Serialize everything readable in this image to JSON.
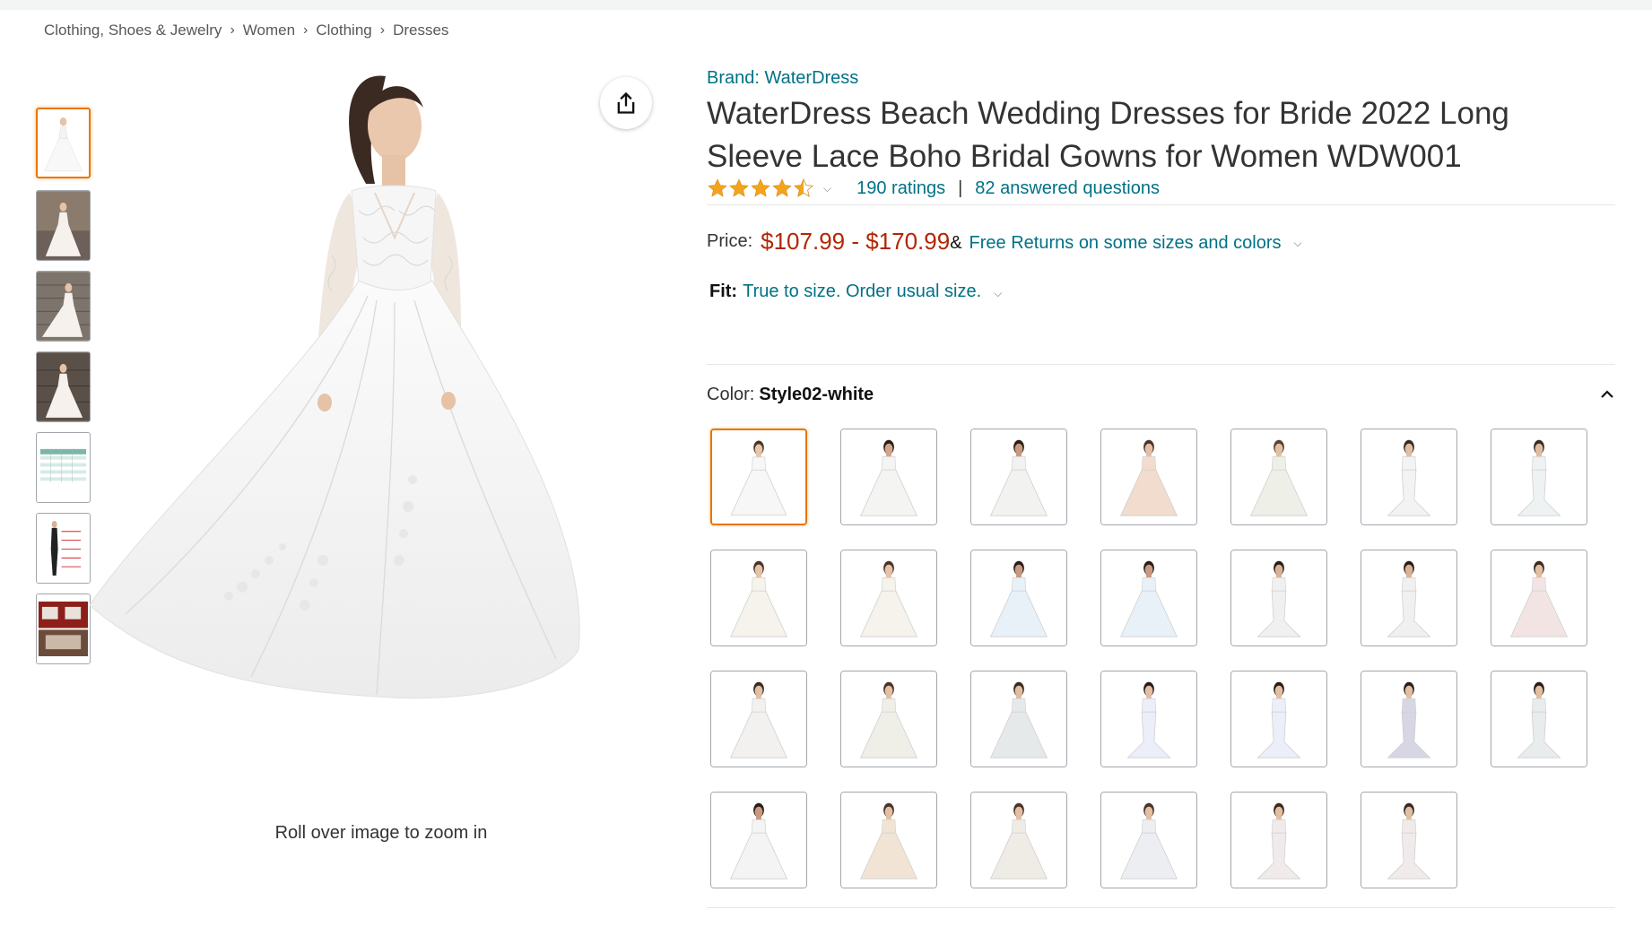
{
  "breadcrumb": {
    "items": [
      "Clothing, Shoes & Jewelry",
      "Women",
      "Clothing",
      "Dresses"
    ],
    "separator": "›"
  },
  "thumbnails": {
    "count": 7,
    "selected_index": 0
  },
  "main_image": {
    "zoom_hint": "Roll over image to zoom in",
    "share_icon": "share-icon"
  },
  "product": {
    "brand": "Brand: WaterDress",
    "title": "WaterDress Beach Wedding Dresses for Bride 2022 Long Sleeve Lace Boho Bridal Gowns for Women WDW001",
    "rating_stars": 4.5,
    "ratings_text": "190 ratings",
    "rating_separator": "|",
    "answered_text": "82 answered questions",
    "price_label": "Price:",
    "price_range": "$107.99 - $170.99",
    "price_amp": "&",
    "returns_text": "Free Returns on some sizes and colors",
    "fit_label": "Fit:",
    "fit_value": "True to size. Order usual size.",
    "color_label": "Color:",
    "color_value": "Style02-white"
  },
  "swatches": {
    "selected_index": 0,
    "items": [
      {
        "dress": "#f7f7f7",
        "skin": "#e9c6a8",
        "hair": "#4a3328"
      },
      {
        "dress": "#f4f4f2",
        "skin": "#d3a58a",
        "hair": "#2a1d18"
      },
      {
        "dress": "#f2f2f0",
        "skin": "#c99a80",
        "hair": "#2a1d18"
      },
      {
        "dress": "#f1dccd",
        "skin": "#e3bfa5",
        "hair": "#4a3328"
      },
      {
        "dress": "#eef0e8",
        "skin": "#e3c0a4",
        "hair": "#5a4030"
      },
      {
        "dress": "#f3f3f3",
        "skin": "#e2bfa2",
        "hair": "#3a2a20"
      },
      {
        "dress": "#eef2f2",
        "skin": "#e0bca0",
        "hair": "#3a2a20"
      },
      {
        "dress": "#f6f3ec",
        "skin": "#e6c3a6",
        "hair": "#4a3328"
      },
      {
        "dress": "#f6f3ec",
        "skin": "#e6c3a6",
        "hair": "#4a3328"
      },
      {
        "dress": "#e8f1f8",
        "skin": "#c99a80",
        "hair": "#2a1d18"
      },
      {
        "dress": "#e8f1f8",
        "skin": "#c99a80",
        "hair": "#2a1d18"
      },
      {
        "dress": "#f0f0f0",
        "skin": "#d8b296",
        "hair": "#2a1d18"
      },
      {
        "dress": "#f0f0f0",
        "skin": "#d8b296",
        "hair": "#2a1d18"
      },
      {
        "dress": "#f3e4e4",
        "skin": "#e2bfa2",
        "hair": "#3a2a20"
      },
      {
        "dress": "#f3f0f0",
        "skin": "#e2bfa2",
        "hair": "#3a2a20"
      },
      {
        "dress": "#efefe8",
        "skin": "#e3c0a4",
        "hair": "#4a3328"
      },
      {
        "dress": "#e6e9ea",
        "skin": "#e0bca0",
        "hair": "#3a2a20"
      },
      {
        "dress": "#eceef9",
        "skin": "#e2bfa2",
        "hair": "#2a1d18"
      },
      {
        "dress": "#eceef9",
        "skin": "#e2bfa2",
        "hair": "#2a1d18"
      },
      {
        "dress": "#d6d6e4",
        "skin": "#e2bfa2",
        "hair": "#2a1d18"
      },
      {
        "dress": "#e8eced",
        "skin": "#e2bfa2",
        "hair": "#2a1d18"
      },
      {
        "dress": "#f4f4f4",
        "skin": "#c99a80",
        "hair": "#2a1d18"
      },
      {
        "dress": "#f1e4d4",
        "skin": "#e3c0a4",
        "hair": "#4a3328"
      },
      {
        "dress": "#efece6",
        "skin": "#e3c0a4",
        "hair": "#4a3328"
      },
      {
        "dress": "#eceef2",
        "skin": "#e3c0a4",
        "hair": "#4a3328"
      },
      {
        "dress": "#f1eaea",
        "skin": "#e2bfa2",
        "hair": "#3a2a20"
      },
      {
        "dress": "#f1eaea",
        "skin": "#e2bfa2",
        "hair": "#3a2a20"
      }
    ]
  },
  "colors": {
    "link": "#007185",
    "price": "#b12704",
    "star": "#f4a41c",
    "selected_border": "#e77600"
  }
}
